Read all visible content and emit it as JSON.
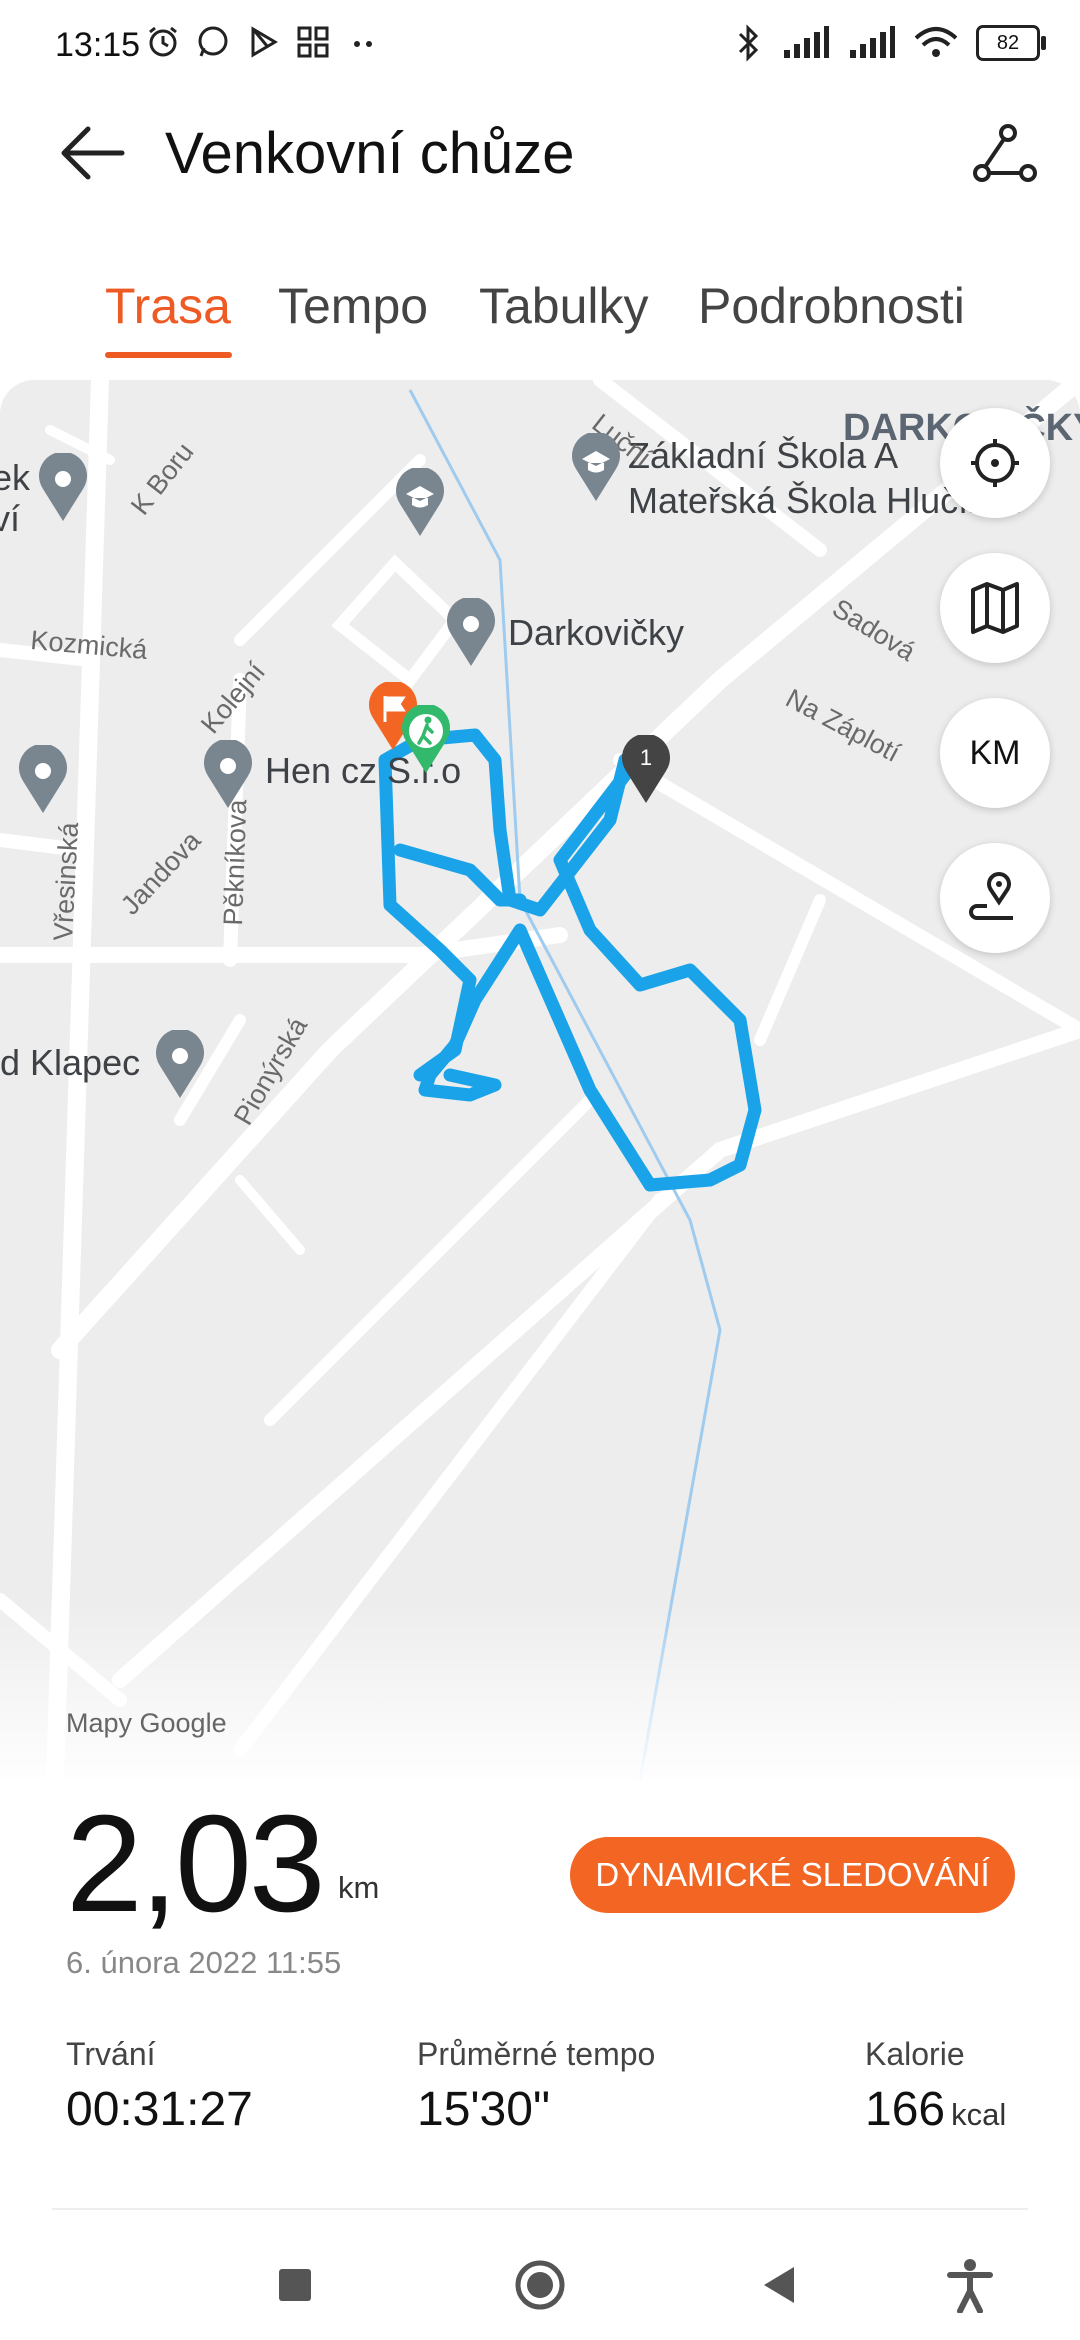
{
  "status_bar": {
    "time": "13:15",
    "battery": "82"
  },
  "app_bar": {
    "title": "Venkovní chůze"
  },
  "tabs": [
    {
      "label": "Trasa",
      "active": true
    },
    {
      "label": "Tempo",
      "active": false
    },
    {
      "label": "Tabulky",
      "active": false
    },
    {
      "label": "Podrobnosti",
      "active": false
    }
  ],
  "map": {
    "place_labels": {
      "village": "DARKOVIČKY",
      "school": "Základní Škola A",
      "school2": "Mateřská Škola Hlučín…",
      "darkovicky": "Darkovičky",
      "hen": "Hen cz S.r.o",
      "klapec": "d Klapec",
      "left_top": "k,",
      "left_mid1": "ek",
      "left_mid2": "ví"
    },
    "streets": {
      "k_boru": "K Boru",
      "lucni": "Luční",
      "peknikova": "Pěkníkova",
      "kozmicka": "Kozmická",
      "kolejni": "Kolejní",
      "sadova": "Sadová",
      "na_zaploti": "Na Záplotí",
      "jandova": "Jandova",
      "vresinska": "Vřesinská",
      "pionyrska": "Pionýrská"
    },
    "marker_number": "1",
    "controls": [
      "locate-icon",
      "map-layers-icon",
      "km-toggle",
      "route-pin-icon"
    ],
    "km_label": "KM",
    "route_color": "#1aa3e8"
  },
  "summary": {
    "attribution": "Mapy Google",
    "distance": "2,03",
    "distance_unit": "km",
    "date": "6. února 2022 11:55",
    "dynamic_button": "DYNAMICKÉ SLEDOVÁNÍ",
    "stats": [
      {
        "label": "Trvání",
        "value": "00:31:27",
        "unit": ""
      },
      {
        "label": "Průměrné tempo",
        "value": "15'30\"",
        "unit": ""
      },
      {
        "label": "Kalorie",
        "value": "166",
        "unit": "kcal"
      }
    ]
  },
  "colors": {
    "accent": "#ee5a24",
    "button": "#f26522",
    "route": "#1aa3e8"
  }
}
